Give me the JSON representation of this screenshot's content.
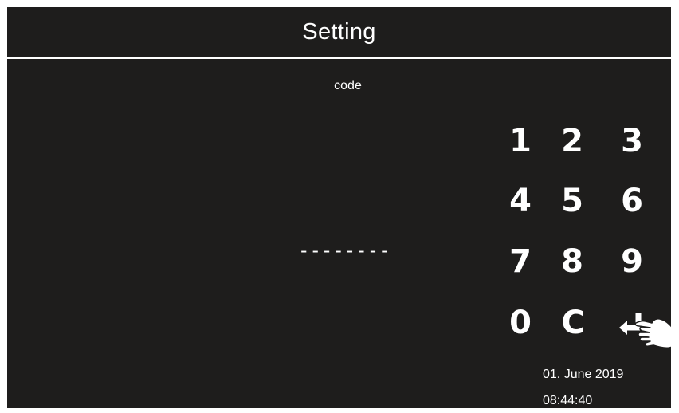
{
  "header": {
    "title": "Setting"
  },
  "code": {
    "label": "code",
    "display": "--------"
  },
  "keypad": {
    "keys": [
      "1",
      "2",
      "3",
      "4",
      "5",
      "6",
      "7",
      "8",
      "9",
      "0",
      "C"
    ],
    "enter_icon": "enter-arrow-icon",
    "pointer_icon": "pointing-hand-icon"
  },
  "status": {
    "date": "01. June 2019",
    "time": "08:44:40"
  },
  "colors": {
    "background": "#1e1d1c",
    "foreground": "#ffffff"
  }
}
